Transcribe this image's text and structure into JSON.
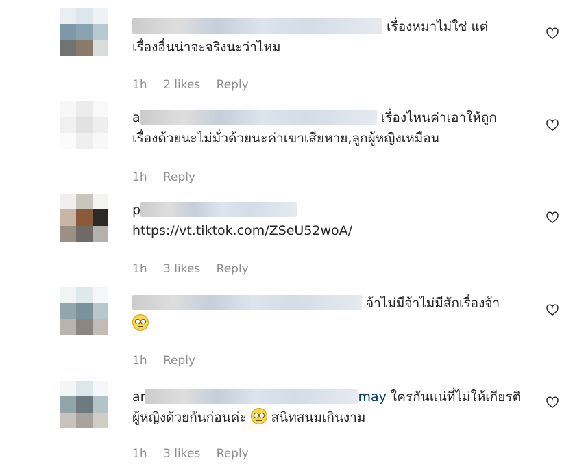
{
  "comments": [
    {
      "username": "",
      "mention": "",
      "line1": "เรื่องหมาไม่ใช่ แต่",
      "line2": "เรื่องอื่นน่าจะจริงนะว่าไหม",
      "time": "1h",
      "likes": "2 likes",
      "reply": "Reply"
    },
    {
      "username": "a",
      "mention": "",
      "line1": "เรื่องไหนค่าเอาให้ถูก",
      "line2": "เรื่องด้วยนะไม่มั่วด้วยนะค่าเขาเสียหาย,ลูกผู้หญิงเหมือน",
      "time": "1h",
      "likes": "",
      "reply": "Reply"
    },
    {
      "username": "p",
      "mention": "",
      "line1": "",
      "line2": "https://vt.tiktok.com/ZSeU52woA/",
      "time": "1h",
      "likes": "3 likes",
      "reply": "Reply"
    },
    {
      "username": "",
      "mention": "",
      "line1": "จ้าไม่มีจ้าไม่มีสักเรื่องจ้า",
      "line2": "",
      "time": "1h",
      "likes": "",
      "reply": "Reply"
    },
    {
      "username": "ar",
      "mention": "may",
      "line1": "ใครกันแน่ที่ไม่ให้เกียรติ",
      "line2": "ผู้หญิงด้วยกันก่อนค่ะ",
      "line2b": "สนิทสนมเกินงาม",
      "time": "1h",
      "likes": "3 likes",
      "reply": "Reply"
    }
  ],
  "icons": {
    "like": "heart-outline-icon",
    "emoji": "face-with-rolling-eyes-emoji"
  }
}
